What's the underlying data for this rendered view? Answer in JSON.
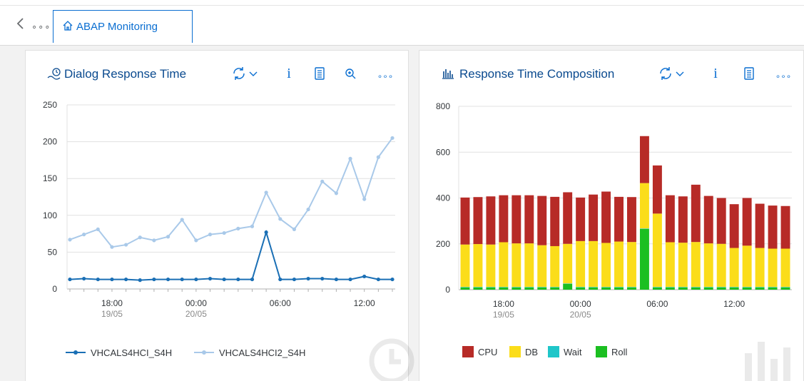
{
  "nav": {
    "back_icon": "chevron-left-icon",
    "overflow_label": "∘∘∘",
    "tab_label": "ABAP Monitoring",
    "tab_icon": "home-icon"
  },
  "colors": {
    "accent": "#0a6ed1",
    "title": "#0a4a8f",
    "cpu": "#b72b27",
    "db": "#fbdd1a",
    "wait": "#1fc6c9",
    "roll": "#1bbf21",
    "series1": "#1a6fb5",
    "series2": "#a9c9e9"
  },
  "left_card": {
    "title": "Dialog Response Time",
    "title_icon": "response-time-icon",
    "toolbar": {
      "refresh_icon": "refresh-icon",
      "dropdown_icon": "chevron-down-icon",
      "info_label": "i",
      "table_icon": "table-view-icon",
      "zoom_icon": "zoom-in-icon",
      "more_label": "∘∘∘"
    }
  },
  "right_card": {
    "title": "Response Time Composition",
    "title_icon": "bar-chart-icon",
    "toolbar": {
      "refresh_icon": "refresh-icon",
      "dropdown_icon": "chevron-down-icon",
      "info_label": "i",
      "table_icon": "table-view-icon",
      "more_label": "∘∘∘"
    }
  },
  "chart_data": [
    {
      "type": "line",
      "title": "Dialog Response Time",
      "ylim": [
        0,
        250
      ],
      "yticks": [
        "0",
        "50",
        "100",
        "150",
        "200",
        "250"
      ],
      "xtick_labels": [
        {
          "index": 3,
          "time": "18:00",
          "date": "19/05"
        },
        {
          "index": 9,
          "time": "00:00",
          "date": "20/05"
        },
        {
          "index": 15,
          "time": "06:00",
          "date": ""
        },
        {
          "index": 21,
          "time": "12:00",
          "date": ""
        }
      ],
      "grid": true,
      "legend_position": "bottom",
      "series": [
        {
          "name": "VHCALS4HCI_S4H",
          "values": [
            13,
            14,
            13,
            13,
            13,
            12,
            13,
            13,
            13,
            13,
            14,
            13,
            13,
            13,
            77,
            13,
            13,
            14,
            14,
            13,
            13,
            17,
            13,
            13
          ]
        },
        {
          "name": "VHCALS4HCI2_S4H",
          "values": [
            67,
            74,
            81,
            57,
            60,
            70,
            66,
            71,
            94,
            66,
            74,
            76,
            82,
            85,
            131,
            95,
            81,
            108,
            146,
            130,
            177,
            122,
            179,
            205
          ]
        }
      ]
    },
    {
      "type": "bar",
      "stacked": true,
      "title": "Response Time Composition",
      "ylim": [
        0,
        800
      ],
      "yticks": [
        "0",
        "200",
        "400",
        "600",
        "800"
      ],
      "xtick_labels": [
        {
          "index": 3,
          "time": "18:00",
          "date": "19/05"
        },
        {
          "index": 9,
          "time": "00:00",
          "date": "20/05"
        },
        {
          "index": 15,
          "time": "06:00",
          "date": ""
        },
        {
          "index": 21,
          "time": "12:00",
          "date": ""
        }
      ],
      "grid": true,
      "legend_position": "bottom-left",
      "series": [
        {
          "name": "CPU",
          "values": [
            205,
            205,
            210,
            205,
            210,
            210,
            215,
            215,
            225,
            190,
            203,
            224,
            195,
            196,
            205,
            210,
            205,
            202,
            250,
            207,
            200,
            191,
            208,
            193,
            188,
            186
          ]
        },
        {
          "name": "DB",
          "values": [
            185,
            187,
            185,
            195,
            190,
            190,
            182,
            178,
            173,
            200,
            200,
            192,
            198,
            196,
            198,
            320,
            195,
            193,
            196,
            190,
            188,
            170,
            180,
            170,
            167,
            167
          ]
        },
        {
          "name": "Wait",
          "values": [
            2,
            2,
            2,
            2,
            2,
            2,
            2,
            2,
            2,
            2,
            2,
            2,
            2,
            2,
            2,
            2,
            2,
            2,
            2,
            2,
            2,
            2,
            2,
            2,
            2,
            2
          ]
        },
        {
          "name": "Roll",
          "values": [
            10,
            10,
            10,
            10,
            10,
            10,
            10,
            10,
            25,
            10,
            10,
            10,
            10,
            10,
            265,
            10,
            10,
            10,
            10,
            10,
            10,
            10,
            10,
            10,
            10,
            10
          ]
        }
      ]
    }
  ]
}
